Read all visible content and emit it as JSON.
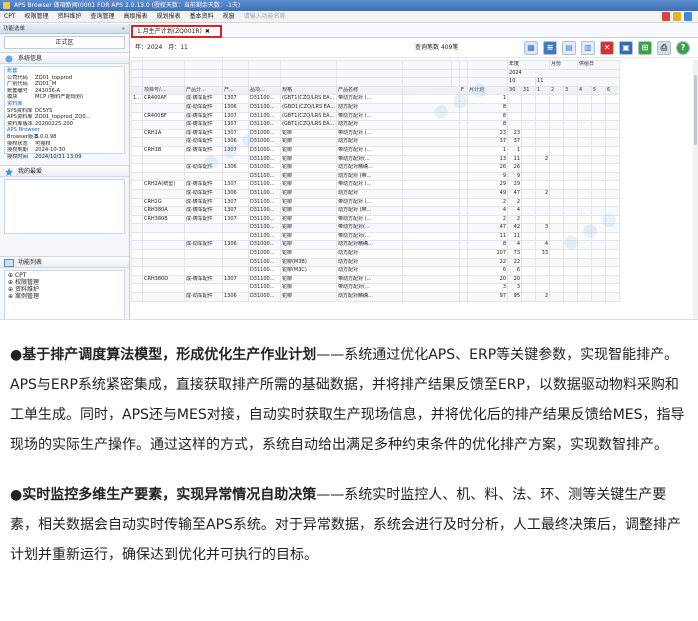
{
  "window": {
    "title": "APS Browser 做項新闻(0001 FOR APS 2.0.13.0 (授权天数：当前剩余天数：-1天)",
    "menus": [
      "CPT",
      "权限管理",
      "资料维护",
      "查询管理",
      "高级报表",
      "规划报表",
      "基本资料",
      "视窗",
      "请输入功能名称"
    ]
  },
  "left_panel": {
    "header": "功能选单",
    "env_button": "正式区",
    "sys_info_title": "系统信息",
    "sys_info": [
      {
        "group": "账套"
      },
      {
        "k": "公司代码",
        "v": "ZQ01_topprod"
      },
      {
        "k": "厂别代码",
        "v": "ZQ01_M"
      },
      {
        "k": "账套编号",
        "v": "241036-A"
      },
      {
        "k": "模块",
        "v": "MCP (物料产能规划)"
      },
      {
        "group": "资料库"
      },
      {
        "k": "SYS资料库",
        "v": "DCSYS"
      },
      {
        "k": "APS资料库",
        "v": "ZQ01_topprod_ZQ0..."
      },
      {
        "k": "资料库版本",
        "v": "20200225.200"
      },
      {
        "group": "APS Browser"
      },
      {
        "k": "Browser版本",
        "v": "3.0.0.98"
      },
      {
        "k": "授权状态",
        "v": "可授权"
      },
      {
        "k": "授权到期",
        "v": "2024-10-30"
      },
      {
        "k": "授权时间",
        "v": "2024/10/31 13:09"
      }
    ],
    "features_title": "我的最爱",
    "func_title": "功能列表",
    "func_list": [
      "CPT",
      "权限管理",
      "资料维护",
      "案例管理"
    ]
  },
  "main": {
    "tab_label": "1.月生产计划(ZQ001R)",
    "year_label": "年：",
    "year_value": "2024",
    "month_label": "月：",
    "month_value": "11",
    "count_text": "查询笔数 409笔",
    "top_header": [
      "年度",
      "月份",
      "供给日"
    ],
    "top_values": [
      "2024",
      "10",
      "11"
    ],
    "columns": [
      "",
      "项目号/...",
      "产品分...",
      "产...",
      "品项...",
      "规格",
      "产品名称",
      "",
      "F",
      "月计划",
      "30",
      "31",
      "1",
      "2",
      "3",
      "4",
      "5",
      "6"
    ],
    "rows": [
      [
        "1...",
        "CR400AF",
        "成-铸车配件",
        "1307",
        "D31100...",
        "(GBT1)CZQ/LRS EA...",
        "带动方配对 (...",
        "",
        "",
        "1",
        "",
        "",
        "",
        "",
        "",
        "",
        "",
        ""
      ],
      [
        "",
        "",
        "成-动车配件",
        "1306",
        "D31100...",
        "(GBD1)CZQ/LRS EA...",
        "动方配对",
        "",
        "",
        "8",
        "",
        "",
        "",
        "",
        "",
        "",
        "",
        ""
      ],
      [
        "",
        "CR400BF",
        "成-铸车配件",
        "1307",
        "D31100...",
        "(GBT1)CZQ/LRS EA...",
        "带动方配对 (...",
        "",
        "",
        "8",
        "",
        "",
        "",
        "",
        "",
        "",
        "",
        ""
      ],
      [
        "",
        "",
        "成-铸车配件",
        "1307",
        "D31100...",
        "(GBT1)CZQ/LRS EA...",
        "动方配对",
        "",
        "",
        "8",
        "",
        "",
        "",
        "",
        "",
        "",
        "",
        ""
      ],
      [
        "",
        "CRH1A",
        "成-铸车配件",
        "1307",
        "D31000...",
        "铊柳",
        "带动方配对 (...",
        "",
        "",
        "23",
        "23",
        "",
        "",
        "",
        "",
        "",
        "",
        ""
      ],
      [
        "",
        "",
        "成-动车配件",
        "1306",
        "D31000...",
        "铊柳",
        "动方配对",
        "",
        "",
        "37",
        "37",
        "",
        "",
        "",
        "",
        "",
        "",
        ""
      ],
      [
        "",
        "CRH1B",
        "成-铸车配件",
        "1307",
        "D31000...",
        "铊柳",
        "带动方配对 (...",
        "",
        "",
        "1",
        "1",
        "",
        "",
        "",
        "",
        "",
        "",
        ""
      ],
      [
        "",
        "",
        "",
        "",
        "D31100...",
        "铊柳",
        "带动方配对(...",
        "",
        "",
        "13",
        "11",
        "",
        "2",
        "",
        "",
        "",
        "",
        ""
      ],
      [
        "",
        "",
        "成-动车配件",
        "1306",
        "D31000...",
        "铊柳",
        "动方配对精确...",
        "",
        "",
        "26",
        "26",
        "",
        "",
        "",
        "",
        "",
        "",
        ""
      ],
      [
        "",
        "",
        "",
        "",
        "D31100...",
        "铊柳",
        "动方配对 (带...",
        "",
        "",
        "9",
        "9",
        "",
        "",
        "",
        "",
        "",
        "",
        ""
      ],
      [
        "",
        "CRH2A(统型)",
        "成-铸车配件",
        "1307",
        "D31100...",
        "铊柳",
        "带动方配对 (...",
        "",
        "",
        "29",
        "29",
        "",
        "",
        "",
        "",
        "",
        "",
        ""
      ],
      [
        "",
        "",
        "成-动车配件",
        "1306",
        "D31100...",
        "铊柳",
        "动方配对",
        "",
        "",
        "49",
        "47",
        "",
        "2",
        "",
        "",
        "",
        "",
        ""
      ],
      [
        "",
        "CRH2G",
        "成-铸车配件",
        "1307",
        "D31100...",
        "铊柳",
        "带动方配对 (...",
        "",
        "",
        "2",
        "2",
        "",
        "",
        "",
        "",
        "",
        "",
        ""
      ],
      [
        "",
        "CRH380A",
        "成-铸车配件",
        "1307",
        "D31100...",
        "铊柳",
        "动方配对 (带...",
        "",
        "",
        "4",
        "4",
        "",
        "",
        "",
        "",
        "",
        "",
        ""
      ],
      [
        "",
        "CRH380B",
        "成-铸车配件",
        "1307",
        "D31100...",
        "铊柳",
        "带动方配对 (...",
        "",
        "",
        "2",
        "2",
        "",
        "",
        "",
        "",
        "",
        "",
        ""
      ],
      [
        "",
        "",
        "",
        "",
        "D31100...",
        "铊柳",
        "带动方配对(...",
        "",
        "",
        "47",
        "42",
        "",
        "3",
        "",
        "",
        "",
        "",
        ""
      ],
      [
        "",
        "",
        "",
        "",
        "D31100...",
        "铊柳",
        "带动方配对(...",
        "",
        "",
        "11",
        "11",
        "",
        "",
        "",
        "",
        "",
        "",
        ""
      ],
      [
        "",
        "",
        "成-动车配件",
        "1306",
        "D31000...",
        "铊柳",
        "动方配对精确...",
        "",
        "",
        "8",
        "4",
        "",
        "4",
        "",
        "",
        "",
        "",
        ""
      ],
      [
        "",
        "",
        "",
        "",
        "D31000...",
        "铊柳",
        "动方配对",
        "",
        "",
        "107",
        "73",
        "",
        "33",
        "",
        "",
        "",
        "",
        ""
      ],
      [
        "",
        "",
        "",
        "",
        "D31100...",
        "铊柳(M3B)",
        "动方配对",
        "",
        "",
        "22",
        "22",
        "",
        "",
        "",
        "",
        "",
        "",
        ""
      ],
      [
        "",
        "",
        "",
        "",
        "D31100...",
        "铊柳(M3C)",
        "动方配对",
        "",
        "",
        "6",
        "6",
        "",
        "",
        "",
        "",
        "",
        "",
        ""
      ],
      [
        "",
        "CRH380D",
        "成-铸车配件",
        "1307",
        "D31100...",
        "铊柳",
        "带动方配对 (...",
        "",
        "",
        "20",
        "20",
        "",
        "",
        "",
        "",
        "",
        "",
        ""
      ],
      [
        "",
        "",
        "",
        "",
        "D31100...",
        "铊柳",
        "带动方配对(...",
        "",
        "",
        "3",
        "3",
        "",
        "",
        "",
        "",
        "",
        "",
        ""
      ],
      [
        "",
        "",
        "成-动车配件",
        "1306",
        "D31000...",
        "铊柳",
        "动方配对精确...",
        "",
        "",
        "97",
        "95",
        "",
        "2",
        "",
        "",
        "",
        "",
        ""
      ]
    ]
  },
  "article": {
    "p1_bold": "●基于排产调度算法模型，形成优化生产作业计划",
    "p1_text": "——系统通过优化APS、ERP等关键参数，实现智能排产。APS与ERP系统紧密集成，直接获取排产所需的基础数据，并将排产结果反馈至ERP，以数据驱动物料采购和工单生成。同时，APS还与MES对接，自动实时获取生产现场信息，并将优化后的排产结果反馈给MES，指导现场的实际生产操作。通过这样的方式，系统自动给出满足多种约束条件的优化排产方案，实现数智排产。",
    "p2_bold": "●实时监控多维生产要素，实现异常情况自助决策",
    "p2_text": "——系统实时监控人、机、料、法、环、测等关键生产要素，相关数据会自动实时传输至APS系统。对于异常数据，系统会进行及时分析，人工最终决策后，调整排产计划并重新运行，确保达到优化并可执行的目标。"
  }
}
